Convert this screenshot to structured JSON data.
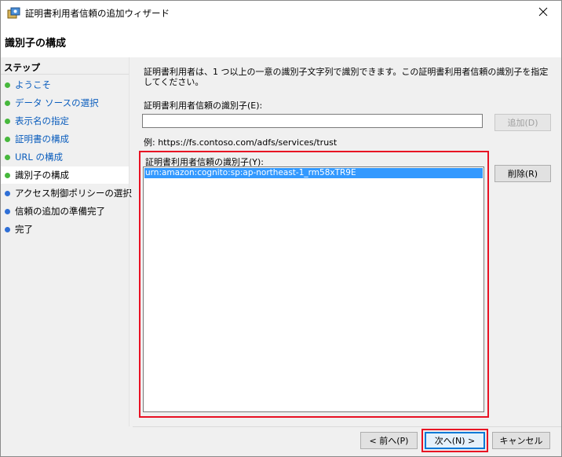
{
  "window": {
    "title": "証明書利用者信頼の追加ウィザード",
    "icon": "wizard-app-icon",
    "close_icon": "close-icon"
  },
  "header": {
    "title": "識別子の構成"
  },
  "steps": {
    "heading": "ステップ",
    "items": [
      {
        "label": "ようこそ",
        "status": "completed",
        "color": "#47b83d"
      },
      {
        "label": "データ ソースの選択",
        "status": "completed",
        "color": "#47b83d"
      },
      {
        "label": "表示名の指定",
        "status": "completed",
        "color": "#47b83d"
      },
      {
        "label": "証明書の構成",
        "status": "completed",
        "color": "#47b83d"
      },
      {
        "label": "URL の構成",
        "status": "completed",
        "color": "#47b83d"
      },
      {
        "label": "識別子の構成",
        "status": "current",
        "color": "#47b83d"
      },
      {
        "label": "アクセス制御ポリシーの選択",
        "status": "pending",
        "color": "#2f6fd6"
      },
      {
        "label": "信頼の追加の準備完了",
        "status": "pending",
        "color": "#2f6fd6"
      },
      {
        "label": "完了",
        "status": "pending",
        "color": "#2f6fd6"
      }
    ]
  },
  "main": {
    "description": "証明書利用者は、1 つ以上の一意の識別子文字列で識別できます。この証明書利用者信頼の識別子を指定してください。",
    "identifier_input": {
      "label": "証明書利用者信頼の識別子(E):",
      "value": "",
      "placeholder": ""
    },
    "add_button": "追加(D)",
    "example": "例: https://fs.contoso.com/adfs/services/trust",
    "identifiers_list": {
      "label": "証明書利用者信頼の識別子(Y):",
      "items": [
        "urn:amazon:cognito:sp:ap-northeast-1_rm58xTR9E"
      ]
    },
    "remove_button": "削除(R)"
  },
  "footer": {
    "back_button": "< 前へ(P)",
    "next_button": "次へ(N) >",
    "cancel_button": "キャンセル"
  },
  "colors": {
    "highlight_outline": "#e81123",
    "selection": "#3399ff",
    "link": "#0a5dbd"
  }
}
